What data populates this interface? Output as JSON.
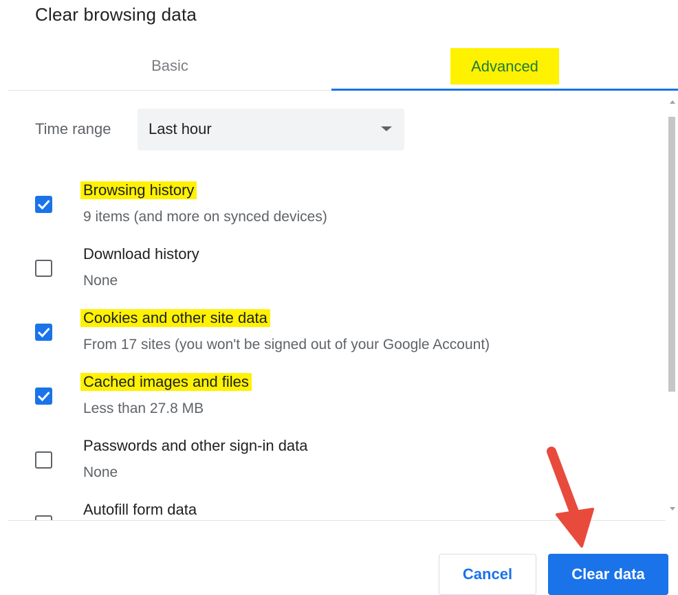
{
  "dialog": {
    "title": "Clear browsing data"
  },
  "tabs": [
    {
      "label": "Basic",
      "selected": false
    },
    {
      "label": "Advanced",
      "selected": true
    }
  ],
  "time_range": {
    "label": "Time range",
    "value": "Last hour"
  },
  "items": [
    {
      "label": "Browsing history",
      "description": "9 items (and more on synced devices)",
      "checked": true,
      "highlighted": true
    },
    {
      "label": "Download history",
      "description": "None",
      "checked": false,
      "highlighted": false
    },
    {
      "label": "Cookies and other site data",
      "description": "From 17 sites (you won't be signed out of your Google Account)",
      "checked": true,
      "highlighted": true
    },
    {
      "label": "Cached images and files",
      "description": "Less than 27.8 MB",
      "checked": true,
      "highlighted": true
    },
    {
      "label": "Passwords and other sign-in data",
      "description": "None",
      "checked": false,
      "highlighted": false
    },
    {
      "label": "Autofill form data",
      "description": "",
      "checked": false,
      "highlighted": false
    }
  ],
  "buttons": {
    "cancel": "Cancel",
    "clear": "Clear data"
  },
  "colors": {
    "accent": "#1a73e8",
    "highlight": "#fff200",
    "annotation_arrow": "#e84b3c"
  },
  "icons": {
    "dropdown": "chevron-down-icon",
    "checkbox_checked": "checkmark-icon",
    "annotation": "red-arrow-icon"
  }
}
